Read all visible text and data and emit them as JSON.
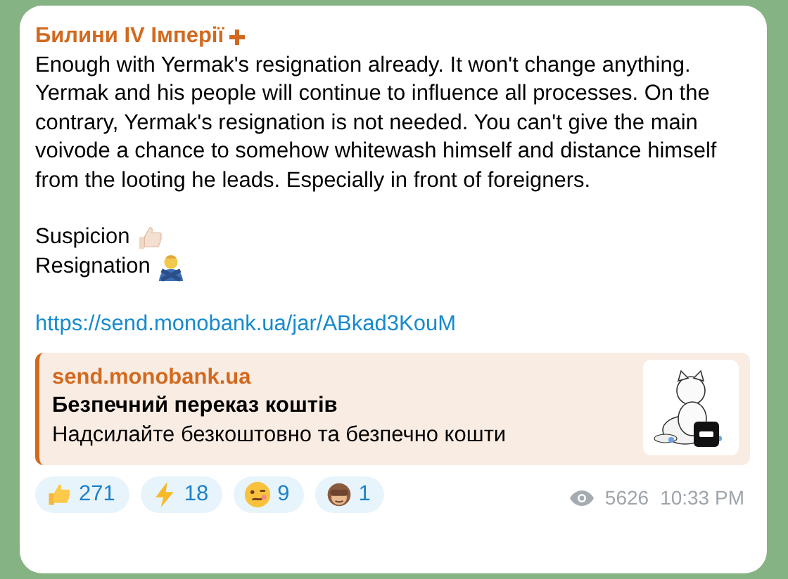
{
  "channel": {
    "title": "Билини IV Імперії"
  },
  "message": {
    "text": "Enough with Yermak's resignation already. It won't change anything. Yermak and his people will continue to influence all processes. On the contrary, Yermak's resignation is not needed. You can't give the main voivode a chance to somehow whitewash himself and distance himself from the looting he leads. Especially in front of foreigners.",
    "lines": [
      {
        "text": "Suspicion"
      },
      {
        "text": "Resignation"
      }
    ],
    "link": "https://send.monobank.ua/jar/ABkad3KouM"
  },
  "preview": {
    "site": "send.monobank.ua",
    "title": "Безпечний переказ коштів",
    "description": "Надсилайте безкоштовно та безпечно кошти"
  },
  "reactions": [
    {
      "count": "271"
    },
    {
      "count": "18"
    },
    {
      "count": "9"
    },
    {
      "count": "1"
    }
  ],
  "views": "5626",
  "time": "10:33 PM"
}
